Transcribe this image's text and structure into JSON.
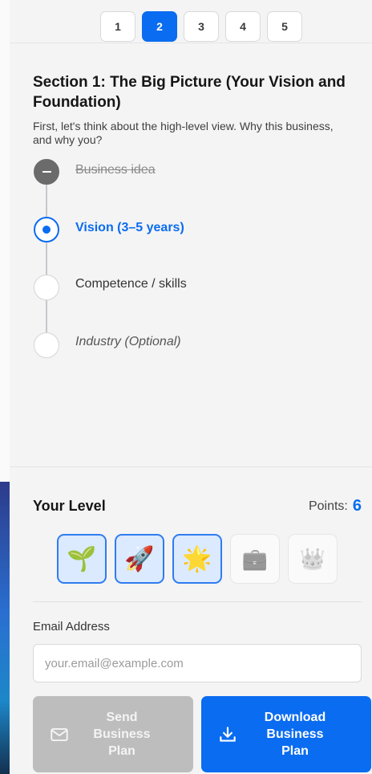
{
  "tabs": [
    "1",
    "2",
    "3",
    "4",
    "5"
  ],
  "active_tab": 2,
  "section": {
    "title": "Section 1: The Big Picture (Your Vision and Foundation)",
    "description": "First, let's think about the high-level view. Why this business, and why you?"
  },
  "steps": [
    {
      "label": "Business idea",
      "state": "done"
    },
    {
      "label": "Vision (3–5 years)",
      "state": "current"
    },
    {
      "label": "Competence / skills",
      "state": "todo"
    },
    {
      "label": "Industry (Optional)",
      "state": "optional"
    }
  ],
  "level": {
    "title": "Your Level",
    "points_label": "Points:",
    "points": "6",
    "badges": [
      {
        "icon": "seedling-icon",
        "glyph": "🌱",
        "unlocked": true
      },
      {
        "icon": "rocket-icon",
        "glyph": "🚀",
        "unlocked": true
      },
      {
        "icon": "star-icon",
        "glyph": "🌟",
        "unlocked": true
      },
      {
        "icon": "briefcase-icon",
        "glyph": "💼",
        "unlocked": false
      },
      {
        "icon": "crown-icon",
        "glyph": "👑",
        "unlocked": false
      }
    ]
  },
  "email": {
    "label": "Email Address",
    "placeholder": "your.email@example.com",
    "value": ""
  },
  "buttons": {
    "send": {
      "label": "Send\nBusiness\nPlan",
      "icon": "envelope-icon",
      "disabled": true
    },
    "download": {
      "label": "Download\nBusiness\nPlan",
      "icon": "download-icon"
    }
  },
  "colors": {
    "accent": "#0a6cf0",
    "disabled": "#bdbdbd",
    "background": "#f4f4f5"
  }
}
